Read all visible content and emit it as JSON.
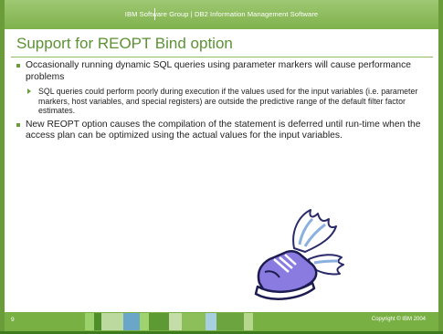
{
  "header": {
    "text": "IBM Software Group  |  DB2 Information Management Software"
  },
  "slide": {
    "title": "Support for REOPT Bind option",
    "bullets": [
      {
        "text": "Occasionally running dynamic SQL queries using parameter markers will cause performance problems"
      },
      {
        "text": "SQL queries could perform poorly during execution if the values used for the input variables (i.e. parameter markers, host variables, and special registers) are outside the predictive range of  the default filter factor estimates."
      },
      {
        "text": "New REOPT option causes the compilation of the statement is deferred until run-time when the access plan can be optimized using the actual values for the input variables."
      }
    ]
  },
  "footer": {
    "page_number": "9",
    "copyright": "Copyright © IBM 2004"
  },
  "colors": {
    "accent": "#6b9c3a",
    "header_green": "#7fb14c",
    "title_green": "#5d9135",
    "footer_green": "#79b043"
  },
  "icons": {
    "illustration": "winged-shoe-icon"
  }
}
